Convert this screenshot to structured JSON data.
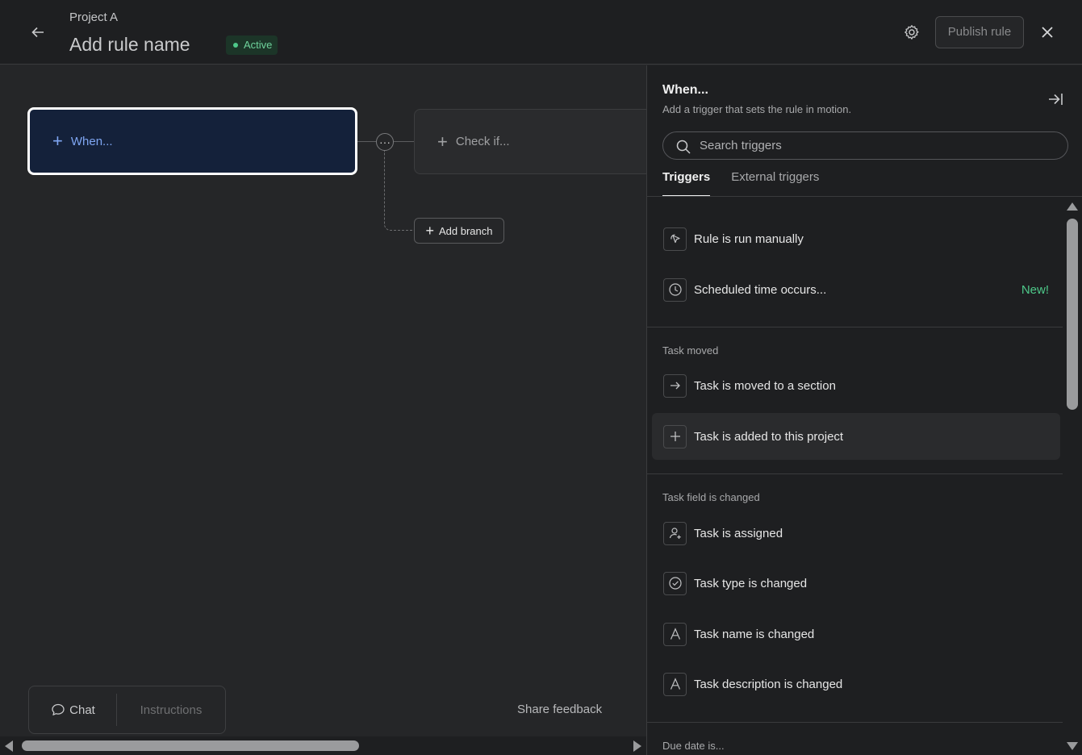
{
  "header": {
    "project_name": "Project A",
    "rule_name": "Add rule name",
    "status": "Active",
    "publish_label": "Publish rule"
  },
  "canvas": {
    "when_label": "When...",
    "check_label": "Check if...",
    "more_label": "···",
    "add_branch_label": "Add branch",
    "toolbar": {
      "chat_label": "Chat",
      "instructions_label": "Instructions"
    },
    "share_feedback_label": "Share feedback"
  },
  "panel": {
    "title": "When...",
    "subtitle": "Add a trigger that sets the rule in motion.",
    "search_placeholder": "Search triggers",
    "tabs": [
      {
        "label": "Triggers",
        "active": true
      },
      {
        "label": "External triggers",
        "active": false
      }
    ],
    "general_items": [
      {
        "label": "Rule is run manually",
        "icon": "cursor-click-icon"
      },
      {
        "label": "Scheduled time occurs...",
        "icon": "clock-icon",
        "badge": "New!"
      }
    ],
    "task_moved": {
      "header": "Task moved",
      "items": [
        {
          "label": "Task is moved to a section",
          "icon": "arrow-right-icon"
        },
        {
          "label": "Task is added to this project",
          "icon": "plus-icon"
        }
      ]
    },
    "task_field_changed": {
      "header": "Task field is changed",
      "items": [
        {
          "label": "Task is assigned",
          "icon": "user-add-icon"
        },
        {
          "label": "Task type is changed",
          "icon": "check-circle-icon"
        },
        {
          "label": "Task name is changed",
          "icon": "letter-a-icon"
        },
        {
          "label": "Task description is changed",
          "icon": "letter-a-icon"
        }
      ]
    },
    "due_date": {
      "header": "Due date is..."
    }
  },
  "colors": {
    "background": "#252628",
    "panel_background": "#1e1f21",
    "when_node_background": "#14213a",
    "accent_blue": "#7fa6f2",
    "status_green": "#4ec98a"
  }
}
